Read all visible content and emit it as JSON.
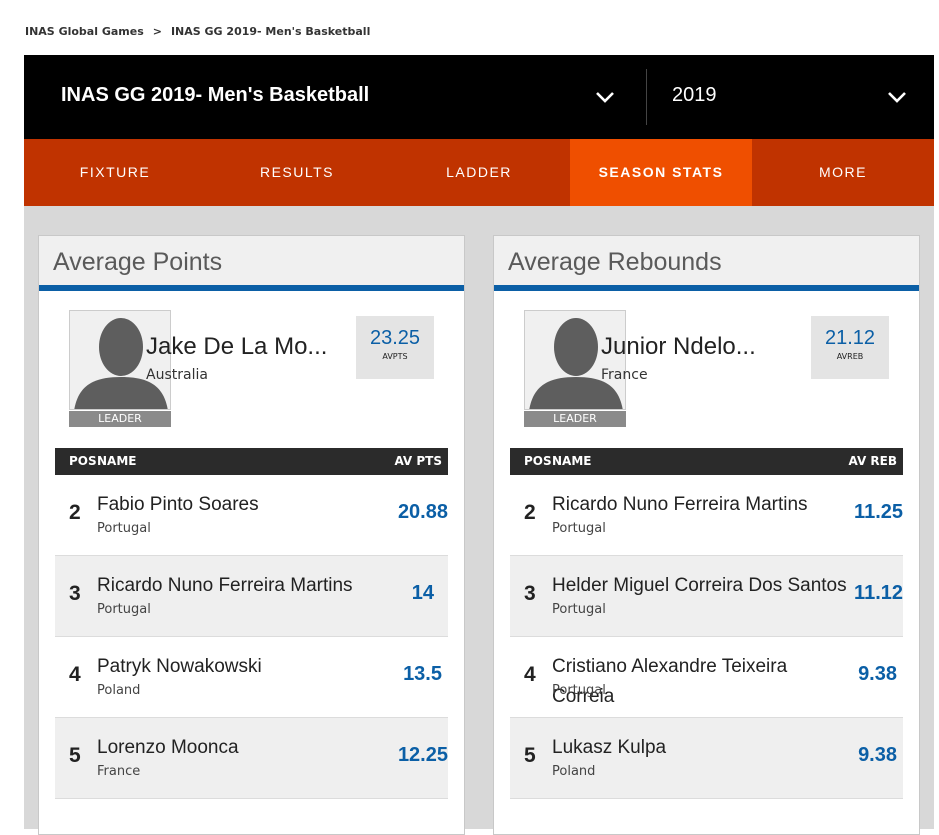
{
  "breadcrumb": {
    "items": [
      "INAS Global Games",
      "INAS GG 2019- Men's Basketball"
    ],
    "sep": ">"
  },
  "header": {
    "title": "INAS GG 2019- Men's Basketball",
    "year": "2019"
  },
  "tabs": [
    {
      "label": "FIXTURE"
    },
    {
      "label": "RESULTS"
    },
    {
      "label": "LADDER"
    },
    {
      "label": "SEASON STATS"
    },
    {
      "label": "MORE"
    }
  ],
  "colors": {
    "accent": "#0b5fa6",
    "tabs_bg": "#c03300",
    "tab_active": "#ef4f00"
  },
  "points": {
    "title": "Average Points",
    "leader": {
      "tag": "LEADER",
      "name": "Jake De La Mo...",
      "country": "Australia",
      "value": "23.25",
      "stat_label": "AVPTS"
    },
    "columns": {
      "pos": "POS",
      "name": "NAME",
      "value": "AV PTS"
    },
    "rows": [
      {
        "rank": "2",
        "name": "Fabio Pinto Soares",
        "country": "Portugal",
        "value": "20.88"
      },
      {
        "rank": "3",
        "name": "Ricardo Nuno Ferreira Martins",
        "country": "Portugal",
        "value": "14"
      },
      {
        "rank": "4",
        "name": "Patryk Nowakowski",
        "country": "Poland",
        "value": "13.5"
      },
      {
        "rank": "5",
        "name": "Lorenzo Mooncа",
        "country": "France",
        "value": "12.25"
      }
    ]
  },
  "rebounds": {
    "title": "Average Rebounds",
    "leader": {
      "tag": "LEADER",
      "name": "Junior Ndelo...",
      "country": "France",
      "value": "21.12",
      "stat_label": "AVREB"
    },
    "columns": {
      "pos": "POS",
      "name": "NAME",
      "value": "AV REB"
    },
    "rows": [
      {
        "rank": "2",
        "name": "Ricardo Nuno Ferreira Martins",
        "country": "Portugal",
        "value": "11.25"
      },
      {
        "rank": "3",
        "name": "Helder Miguel Correira Dos Santos",
        "country": "Portugal",
        "value": "11.12"
      },
      {
        "rank": "4",
        "name": "Cristiano Alexandre Teixeira Correia",
        "country": "Portugal",
        "value": "9.38"
      },
      {
        "rank": "5",
        "name": "Lukasz Kulpa",
        "country": "Poland",
        "value": "9.38"
      }
    ]
  }
}
